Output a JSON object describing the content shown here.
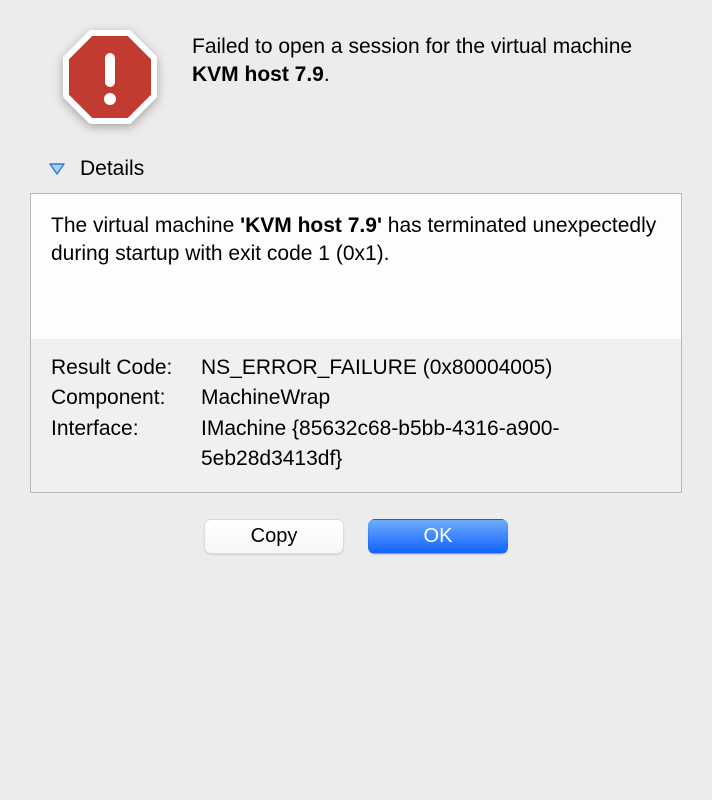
{
  "header": {
    "text_prefix": "Failed to open a session for the virtual machine ",
    "machine_name": "KVM host 7.9",
    "text_suffix": "."
  },
  "details": {
    "toggle_label": "Details",
    "message_prefix": "The virtual machine ",
    "message_machine": "'KVM host 7.9'",
    "message_suffix": " has terminated unexpectedly during startup with exit code 1 (0x1).",
    "rows": {
      "result_code": {
        "label": "Result Code:",
        "value": "NS_ERROR_FAILURE (0x80004005)"
      },
      "component": {
        "label": "Component:",
        "value": "MachineWrap"
      },
      "interface": {
        "label": "Interface:",
        "value": "IMachine {85632c68-b5bb-4316-a900-5eb28d3413df}"
      }
    }
  },
  "buttons": {
    "copy": "Copy",
    "ok": "OK"
  }
}
